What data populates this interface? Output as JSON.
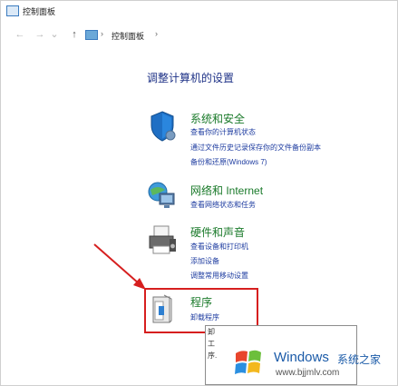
{
  "window": {
    "title": "控制面板"
  },
  "navigation": {
    "back_icon": "arrow-left-icon",
    "forward_icon": "arrow-right-icon",
    "up_icon": "arrow-up-icon",
    "breadcrumb": [
      "控制面板"
    ]
  },
  "main": {
    "heading": "调整计算机的设置",
    "categories": [
      {
        "icon": "shield-icon",
        "title": "系统和安全",
        "links": [
          "查看你的计算机状态",
          "通过文件历史记录保存你的文件备份副本",
          "备份和还原(Windows 7)"
        ]
      },
      {
        "icon": "globe-network-icon",
        "title": "网络和 Internet",
        "links": [
          "查看网络状态和任务"
        ]
      },
      {
        "icon": "printer-icon",
        "title": "硬件和声音",
        "links": [
          "查看设备和打印机",
          "添加设备",
          "调整常用移动设置"
        ]
      },
      {
        "icon": "programs-icon",
        "title": "程序",
        "links": [
          "卸载程序"
        ]
      }
    ]
  },
  "tooltip": {
    "lines": [
      "卸",
      "工",
      "序."
    ]
  },
  "watermark": {
    "brand": "Windows",
    "brand_cn": "系统之家",
    "url": "www.bjjmlv.com"
  },
  "colors": {
    "highlight": "#d61f1f",
    "link": "#1e3ca0",
    "category_title": "#1a7a2a",
    "heading": "#1e3287",
    "watermark": "#1a5aa8"
  }
}
